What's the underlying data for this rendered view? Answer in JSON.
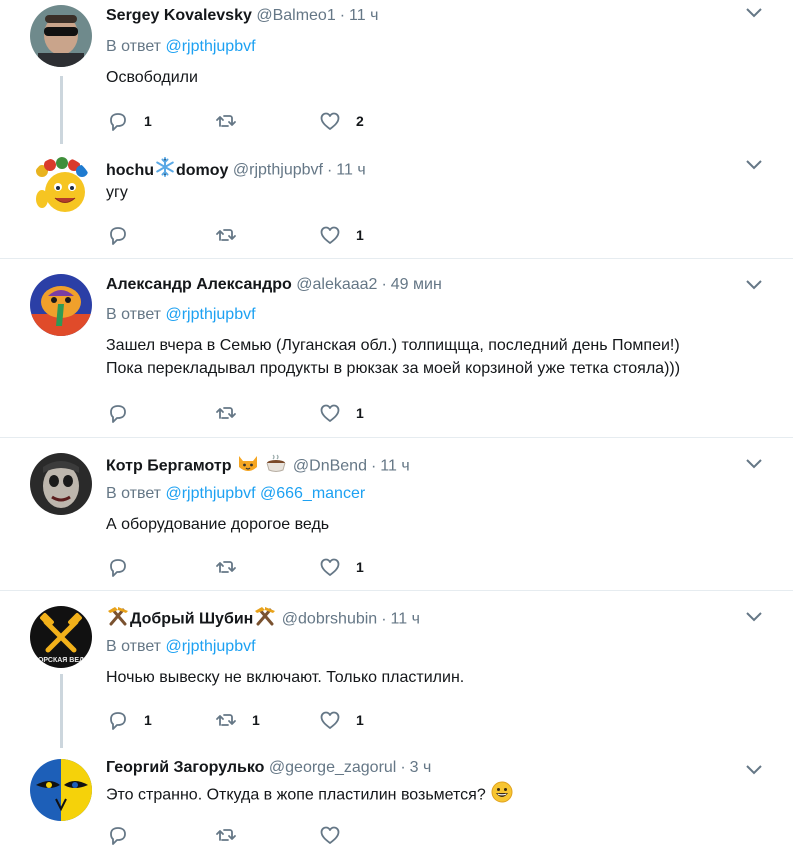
{
  "tweets": [
    {
      "name": "Sergey Kovalevsky",
      "name_suffix": "",
      "handle": "@Balmeo1",
      "time": "11 ч",
      "reply_prefix": "В ответ",
      "reply_mentions": "@rjpthjupbvf",
      "lines": [
        "Освободили"
      ],
      "replies": "1",
      "retweets": "",
      "likes": "2"
    },
    {
      "name": "hochu",
      "name_suffix": "domoy",
      "handle": "@rjpthjupbvf",
      "time": "11 ч",
      "reply_prefix": "",
      "reply_mentions": "",
      "lines": [
        "угу"
      ],
      "replies": "",
      "retweets": "",
      "likes": "1"
    },
    {
      "name": "Александр Александро",
      "name_suffix": "",
      "handle": "@alekaaa2",
      "time": "49 мин",
      "reply_prefix": "В ответ",
      "reply_mentions": "@rjpthjupbvf",
      "lines": [
        "Зашел вчера в Семью (Луганская обл.) толпищща, последний день Помпеи!)",
        "Пока перекладывал продукты в рюкзак за моей корзиной уже тетка стояла)))"
      ],
      "replies": "",
      "retweets": "",
      "likes": "1"
    },
    {
      "name": "Котр Бергамотр",
      "name_suffix": "",
      "handle": "@DnBend",
      "time": "11 ч",
      "reply_prefix": "В ответ",
      "reply_mentions": "@rjpthjupbvf @666_mancer",
      "lines": [
        "А оборудование дорогое ведь"
      ],
      "replies": "",
      "retweets": "",
      "likes": "1"
    },
    {
      "name": "Добрый Шубин",
      "name_suffix": "",
      "handle": "@dobrshubin",
      "time": "11 ч",
      "reply_prefix": "В ответ",
      "reply_mentions": "@rjpthjupbvf",
      "lines": [
        "Ночью вывеску не включают. Только пластилин."
      ],
      "replies": "1",
      "retweets": "1",
      "likes": "1"
    },
    {
      "name": "Георгий Загорулько",
      "name_suffix": "",
      "handle": "@george_zagorul",
      "time": "3 ч",
      "reply_prefix": "",
      "reply_mentions": "",
      "lines": [
        "Это странно. Откуда в жопе пластилин возьмется?"
      ],
      "replies": "",
      "retweets": "",
      "likes": ""
    }
  ],
  "avatar_labels": {
    "dobrshubin_avatar_text": "ОРСКАЯ ВЕД"
  },
  "icons": {
    "reply": "reply-icon",
    "retweet": "retweet-icon",
    "like": "heart-icon",
    "menu": "chevron-down-icon"
  },
  "colors": {
    "name": "#14171a",
    "meta": "#657786",
    "mention": "#1da1f2",
    "divider": "#e6ecf0",
    "thread_line": "#ccd6dd"
  }
}
